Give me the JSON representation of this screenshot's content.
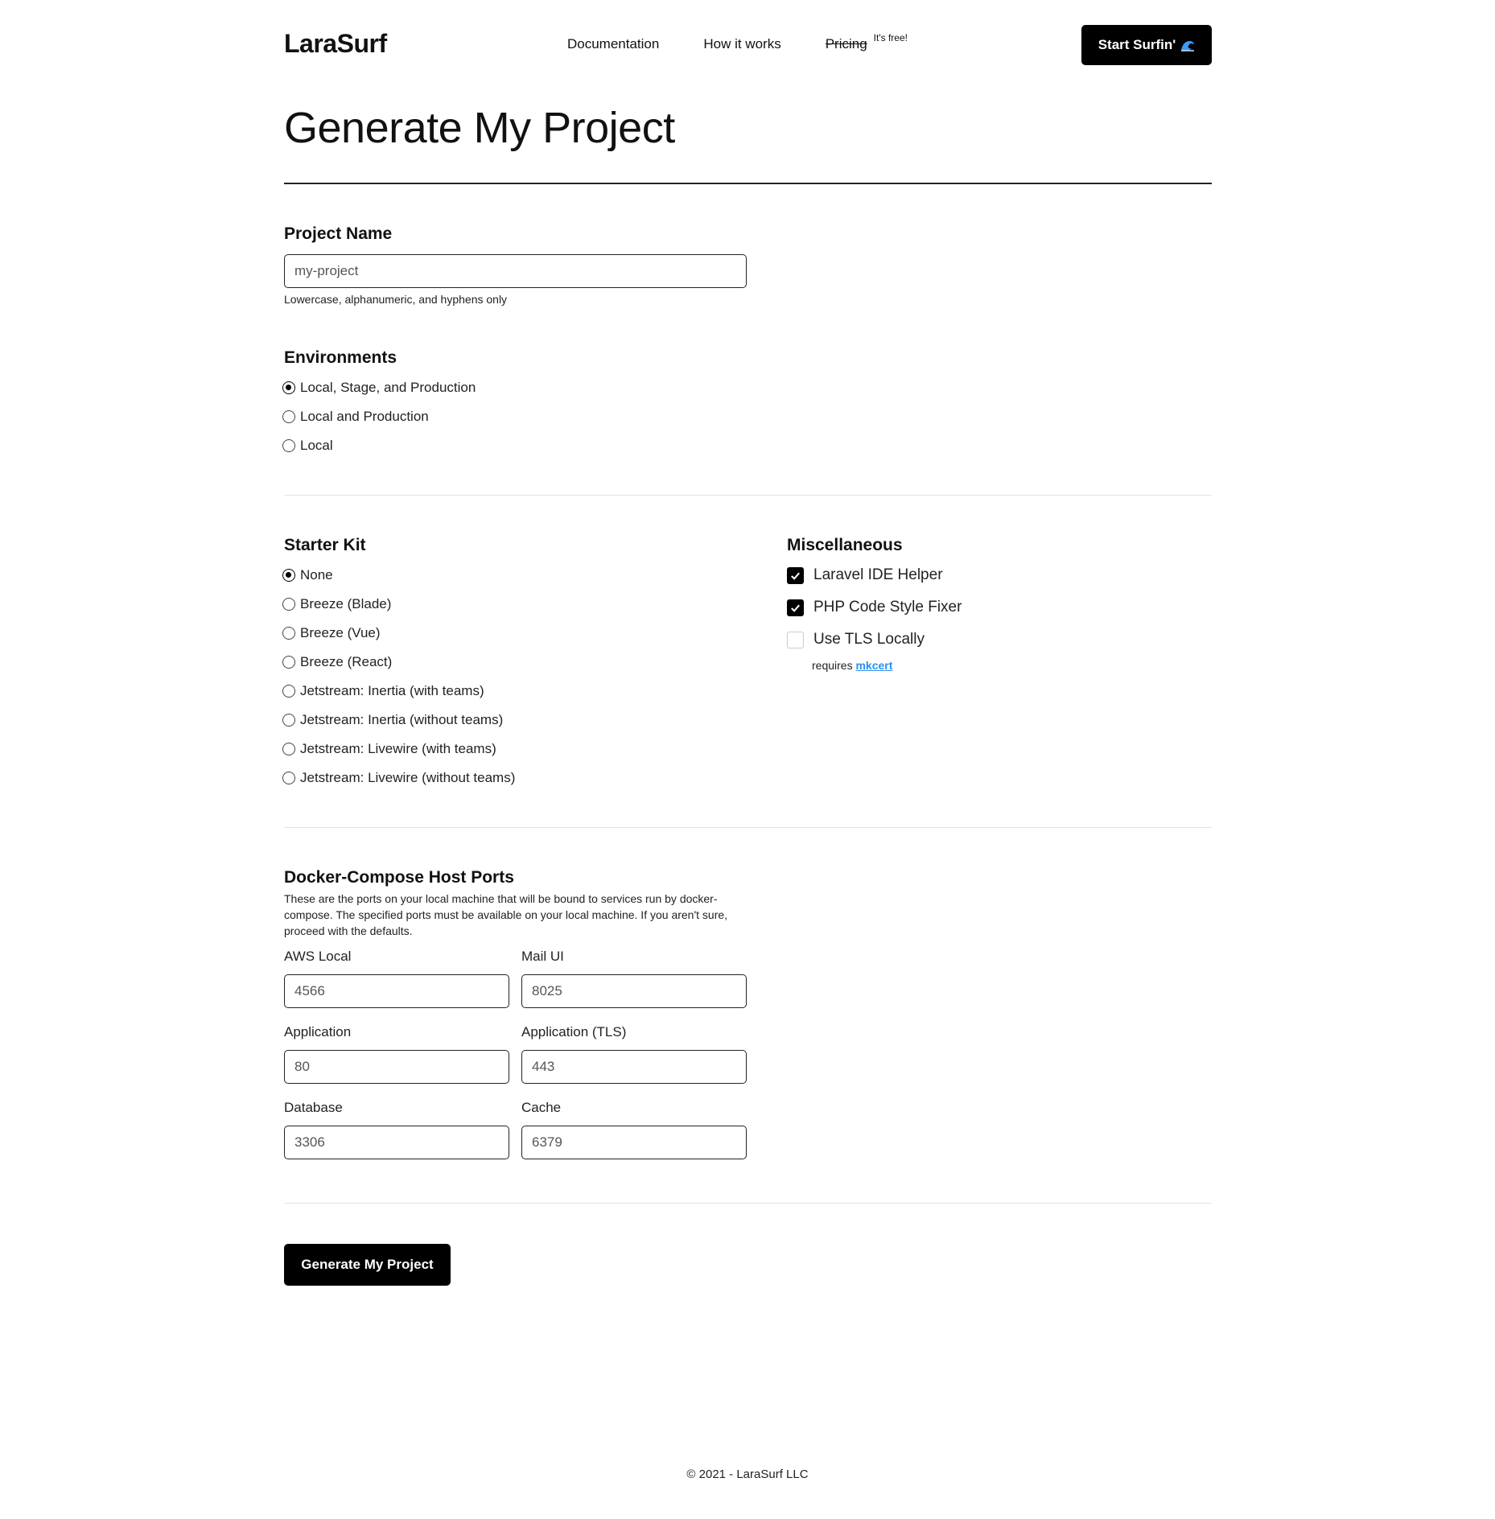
{
  "header": {
    "logo": "LaraSurf",
    "nav": {
      "documentation": "Documentation",
      "how_it_works": "How it works",
      "pricing": "Pricing",
      "pricing_note": "It's free!"
    },
    "cta_label": "Start Surfin'",
    "cta_icon": "wave-icon"
  },
  "page": {
    "title": "Generate My Project"
  },
  "project_name": {
    "label": "Project Name",
    "value": "my-project",
    "hint": "Lowercase, alphanumeric, and hyphens only"
  },
  "environments": {
    "label": "Environments",
    "selected": 0,
    "options": [
      "Local, Stage, and Production",
      "Local and Production",
      "Local"
    ]
  },
  "starter_kit": {
    "label": "Starter Kit",
    "selected": 0,
    "options": [
      "None",
      "Breeze (Blade)",
      "Breeze (Vue)",
      "Breeze (React)",
      "Jetstream: Inertia (with teams)",
      "Jetstream: Inertia (without teams)",
      "Jetstream: Livewire (with teams)",
      "Jetstream: Livewire (without teams)"
    ]
  },
  "misc": {
    "label": "Miscellaneous",
    "options": [
      {
        "label": "Laravel IDE Helper",
        "checked": true
      },
      {
        "label": "PHP Code Style Fixer",
        "checked": true
      },
      {
        "label": "Use TLS Locally",
        "checked": false
      }
    ],
    "requires_text": "requires",
    "requires_link": "mkcert"
  },
  "ports": {
    "label": "Docker-Compose Host Ports",
    "description": "These are the ports on your local machine that will be bound to services run by docker-compose. The specified ports must be available on your local machine. If you aren't sure, proceed with the defaults.",
    "aws_local": {
      "label": "AWS Local",
      "value": "4566"
    },
    "mail_ui": {
      "label": "Mail UI",
      "value": "8025"
    },
    "application": {
      "label": "Application",
      "value": "80"
    },
    "application_tls": {
      "label": "Application (TLS)",
      "value": "443"
    },
    "database": {
      "label": "Database",
      "value": "3306"
    },
    "cache": {
      "label": "Cache",
      "value": "6379"
    }
  },
  "submit_label": "Generate My Project",
  "footer": {
    "copyright": "© 2021 - LaraSurf LLC"
  },
  "colors": {
    "accent": "#000000",
    "link": "#2a8ff0",
    "wave": "#3b9bf5"
  }
}
